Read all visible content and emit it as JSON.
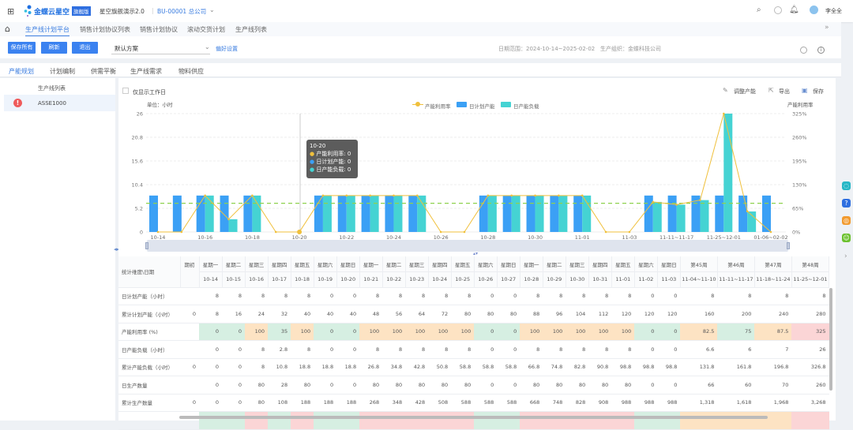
{
  "topbar": {
    "brand": "金蝶云星空",
    "edition": "旗舰版",
    "workspace": "星空旗舰演示2.0",
    "org": "BU-00001 总公司",
    "user": "李全全"
  },
  "nav": {
    "tabs": [
      "生产线计划平台",
      "销售计划协议列表",
      "销售计划协议",
      "滚动交货计划",
      "生产线列表"
    ],
    "active": 0
  },
  "toolbar": {
    "save_all": "保存所有",
    "refresh": "刷新",
    "exit": "退出",
    "scheme": "默认方案",
    "preference": "偏好设置",
    "date_range": "日期范围：2024-10-14~2025-02-02",
    "org_label": "生产组织：金蝶科技公司"
  },
  "subtabs": {
    "items": [
      "产能规划",
      "计划编制",
      "供需平衡",
      "生产线需求",
      "物料供应"
    ],
    "active": 0
  },
  "leftpanel": {
    "header": "生产线列表",
    "items": [
      {
        "name": "ASSE1000",
        "status": "error"
      }
    ]
  },
  "chart_tools": {
    "workday_only": "仅显示工作日",
    "adjust": "调整产能",
    "export": "导出",
    "save": "保存"
  },
  "colors": {
    "plan": "#3ba0f5",
    "load": "#45d3d3",
    "util": "#f0c03c",
    "threshold": "#8fd14f",
    "good": "#d6efe2",
    "warn": "#fde3c3",
    "over": "#fbd5d6"
  },
  "tooltip": {
    "title": "10-20",
    "rows": [
      "产能利用率: 0",
      "日计划产能: 0",
      "日产能负载: 0"
    ]
  },
  "chart_data": {
    "type": "bar",
    "unit_label": "单位：小时",
    "y2label": "产能利用率",
    "categories": [
      "10-14",
      "10-15",
      "10-16",
      "10-17",
      "10-18",
      "10-19",
      "10-20",
      "10-21",
      "10-22",
      "10-23",
      "10-24",
      "10-25",
      "10-26",
      "10-27",
      "10-28",
      "10-29",
      "10-30",
      "10-31",
      "11-01",
      "11-02",
      "11-03",
      "11-04~11-10",
      "11-11~11-17",
      "11-18~11-24",
      "11-25~12-01",
      "12-02~01-05",
      "01-06~02-02"
    ],
    "xtick_labels": [
      "10-14",
      "10-16",
      "10-18",
      "10-20",
      "10-22",
      "10-24",
      "10-26",
      "10-28",
      "10-30",
      "11-01",
      "11-03",
      "11-11~11-17",
      "11-25~12-01",
      "01-06~02-02"
    ],
    "series": [
      {
        "name": "日计划产能",
        "type": "bar",
        "axis": "left",
        "values": [
          8,
          8,
          8,
          8,
          8,
          0,
          0,
          8,
          8,
          8,
          8,
          8,
          0,
          0,
          8,
          8,
          8,
          8,
          8,
          0,
          0,
          8,
          8,
          8,
          8,
          8,
          8
        ]
      },
      {
        "name": "日产能负载",
        "type": "bar",
        "axis": "left",
        "values": [
          0,
          0,
          8,
          2.8,
          8,
          0,
          0,
          8,
          8,
          8,
          8,
          8,
          0,
          0,
          8,
          8,
          8,
          8,
          8,
          0,
          0,
          6.6,
          6,
          7,
          26,
          4.5,
          0
        ]
      },
      {
        "name": "产能利用率",
        "type": "line",
        "axis": "right",
        "values": [
          0,
          0,
          100,
          35,
          100,
          0,
          0,
          100,
          100,
          100,
          100,
          100,
          0,
          0,
          100,
          100,
          100,
          100,
          100,
          0,
          0,
          82.5,
          75,
          87.5,
          325,
          57,
          0
        ]
      }
    ],
    "threshold_line": 6.3,
    "yticks": [
      "0",
      "5.2",
      "10.4",
      "15.6",
      "20.8",
      "26"
    ],
    "y2ticks": [
      "0%",
      "65%",
      "130%",
      "195%",
      "260%",
      "325%"
    ],
    "ylim": [
      0,
      26
    ],
    "y2lim": [
      0,
      325
    ],
    "grid": true,
    "legend": "top-center"
  },
  "table": {
    "corner": "统计维度\\日期",
    "opening": "期初",
    "columns": [
      [
        "星期一",
        "10-14"
      ],
      [
        "星期二",
        "10-15"
      ],
      [
        "星期三",
        "10-16"
      ],
      [
        "星期四",
        "10-17"
      ],
      [
        "星期五",
        "10-18"
      ],
      [
        "星期六",
        "10-19"
      ],
      [
        "星期日",
        "10-20"
      ],
      [
        "星期一",
        "10-21"
      ],
      [
        "星期二",
        "10-22"
      ],
      [
        "星期三",
        "10-23"
      ],
      [
        "星期四",
        "10-24"
      ],
      [
        "星期五",
        "10-25"
      ],
      [
        "星期六",
        "10-26"
      ],
      [
        "星期日",
        "10-27"
      ],
      [
        "星期一",
        "10-28"
      ],
      [
        "星期二",
        "10-29"
      ],
      [
        "星期三",
        "10-30"
      ],
      [
        "星期四",
        "10-31"
      ],
      [
        "星期五",
        "11-01"
      ],
      [
        "星期六",
        "11-02"
      ],
      [
        "星期日",
        "11-03"
      ],
      [
        "第45周",
        "11-04~11-10"
      ],
      [
        "第46周",
        "11-11~11-17"
      ],
      [
        "第47周",
        "11-18~11-24"
      ],
      [
        "第48周",
        "11-25~12-01"
      ]
    ],
    "rows": [
      {
        "label": "日计划产能（小时）",
        "opening": "",
        "values": [
          "8",
          "8",
          "8",
          "8",
          "8",
          "0",
          "0",
          "8",
          "8",
          "8",
          "8",
          "8",
          "0",
          "0",
          "8",
          "8",
          "8",
          "8",
          "8",
          "0",
          "0",
          "8",
          "8",
          "8",
          "8"
        ]
      },
      {
        "label": "累计计划产能（小时）",
        "opening": "0",
        "values": [
          "8",
          "16",
          "24",
          "32",
          "40",
          "40",
          "40",
          "48",
          "56",
          "64",
          "72",
          "80",
          "80",
          "80",
          "88",
          "96",
          "104",
          "112",
          "120",
          "120",
          "120",
          "160",
          "200",
          "240",
          "280"
        ]
      },
      {
        "label": "产能利用率 (%)",
        "opening": "",
        "values": [
          "0",
          "0",
          "100",
          "35",
          "100",
          "0",
          "0",
          "100",
          "100",
          "100",
          "100",
          "100",
          "0",
          "0",
          "100",
          "100",
          "100",
          "100",
          "100",
          "0",
          "0",
          "82.5",
          "75",
          "87.5",
          "325"
        ],
        "status": [
          "g",
          "g",
          "o",
          "g",
          "o",
          "g",
          "g",
          "o",
          "o",
          "o",
          "o",
          "o",
          "g",
          "g",
          "o",
          "o",
          "o",
          "o",
          "o",
          "g",
          "g",
          "o",
          "g",
          "o",
          "p"
        ]
      },
      {
        "label": "日产能负载（小时）",
        "opening": "",
        "values": [
          "0",
          "0",
          "8",
          "2.8",
          "8",
          "0",
          "0",
          "8",
          "8",
          "8",
          "8",
          "8",
          "0",
          "0",
          "8",
          "8",
          "8",
          "8",
          "8",
          "0",
          "0",
          "6.6",
          "6",
          "7",
          "26"
        ]
      },
      {
        "label": "累计产能负载（小时）",
        "opening": "0",
        "values": [
          "0",
          "0",
          "8",
          "10.8",
          "18.8",
          "18.8",
          "18.8",
          "26.8",
          "34.8",
          "42.8",
          "50.8",
          "58.8",
          "58.8",
          "58.8",
          "66.8",
          "74.8",
          "82.8",
          "90.8",
          "98.8",
          "98.8",
          "98.8",
          "131.8",
          "161.8",
          "196.8",
          "326.8"
        ]
      },
      {
        "label": "日生产数量",
        "opening": "",
        "values": [
          "0",
          "0",
          "80",
          "28",
          "80",
          "0",
          "0",
          "80",
          "80",
          "80",
          "80",
          "80",
          "0",
          "0",
          "80",
          "80",
          "80",
          "80",
          "80",
          "0",
          "0",
          "66",
          "60",
          "70",
          "260"
        ]
      },
      {
        "label": "累计生产数量",
        "opening": "0",
        "values": [
          "0",
          "0",
          "80",
          "108",
          "188",
          "188",
          "188",
          "268",
          "348",
          "428",
          "508",
          "588",
          "588",
          "588",
          "668",
          "748",
          "828",
          "908",
          "988",
          "988",
          "988",
          "1,318",
          "1,618",
          "1,968",
          "3,268"
        ]
      }
    ],
    "strip": [
      "g",
      "g",
      "p",
      "g",
      "p",
      "g",
      "g",
      "p",
      "p",
      "p",
      "p",
      "p",
      "g",
      "g",
      "p",
      "p",
      "p",
      "p",
      "p",
      "g",
      "g",
      "o",
      "o",
      "o",
      "p"
    ]
  }
}
